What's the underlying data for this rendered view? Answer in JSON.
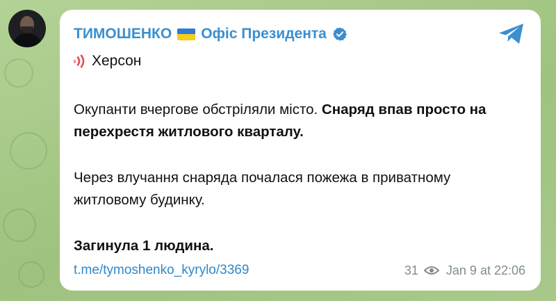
{
  "post": {
    "channel_name": "ТИМОШЕНКО",
    "channel_suffix": "Офіс Президента",
    "title": "Херсон",
    "para1_regular": "Окупанти вчергове обстріляли місто. ",
    "para1_bold": "Снаряд впав просто на перехрестя житлового кварталу.",
    "para2": "Через влучання снаряда почалася пожежа в приватному житловому будинку.",
    "para3": "Загинула 1 людина.",
    "link": "t.me/tymoshenko_kyrylo/3369",
    "views": "31",
    "timestamp": "Jan 9 at 22:06"
  },
  "colors": {
    "accent": "#3a8fd0",
    "link": "#2f87c8",
    "meta": "#7f8c8d",
    "background": "#a9c98a",
    "signal_red": "#e84c4c"
  },
  "icons": {
    "flag": "ukraine-flag-icon",
    "verified": "verified-badge-icon",
    "share": "telegram-share-icon",
    "signal": "broadcast-signal-icon",
    "views": "eye-icon"
  }
}
